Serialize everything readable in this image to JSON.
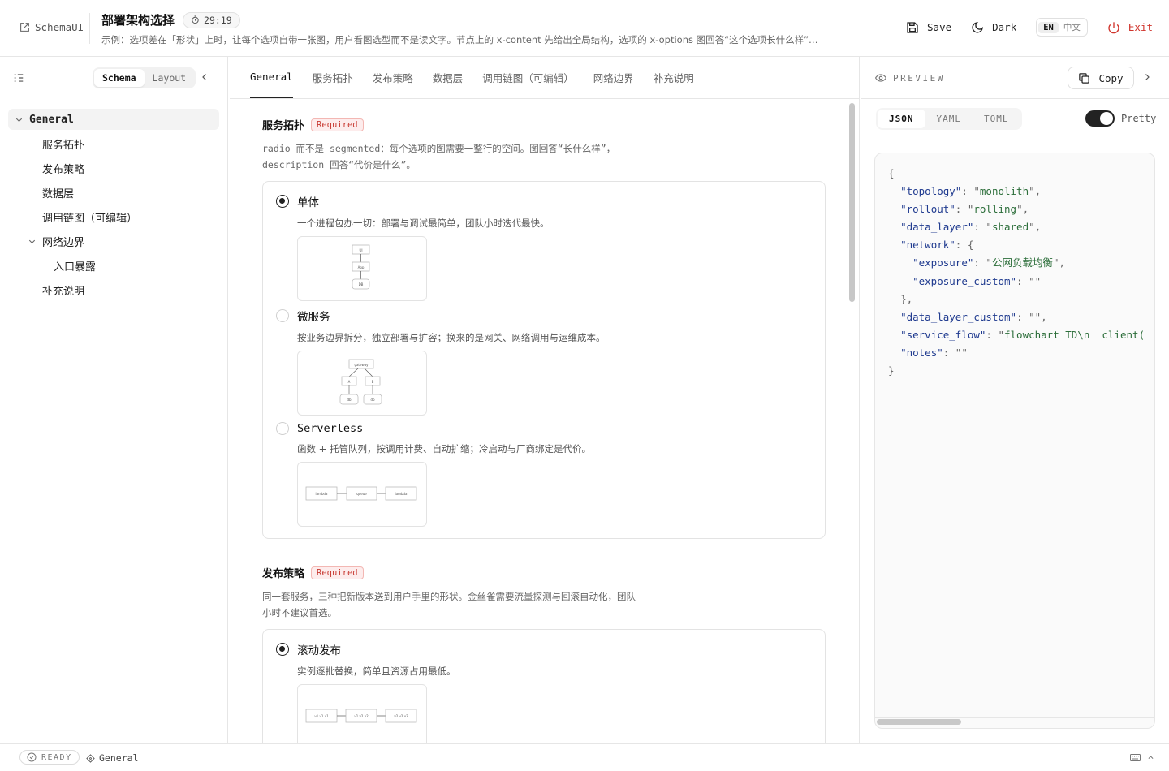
{
  "header": {
    "brand": "SchemaUI",
    "title": "部署架构选择",
    "timer": "29:19",
    "subtitle": "示例：选项差在「形状」上时，让每个选项自带一张图，用户看图选型而不是读文字。节点上的 x-content 先给出全局结构，选项的 x-options 图回答“这个选项长什么样”…",
    "save_label": "Save",
    "theme_label": "Dark",
    "lang_active": "EN",
    "lang_other": "中文",
    "exit_label": "Exit"
  },
  "left_panel": {
    "segments": [
      "Schema",
      "Layout"
    ],
    "active_segment": "Schema",
    "tree": {
      "root": "General",
      "items": [
        "服务拓扑",
        "发布策略",
        "数据层",
        "调用链图（可编辑）"
      ],
      "group": "网络边界",
      "group_children": [
        "入口暴露"
      ],
      "last": "补充说明"
    }
  },
  "tabs": [
    "General",
    "服务拓扑",
    "发布策略",
    "数据层",
    "调用链图（可编辑）",
    "网络边界",
    "补充说明"
  ],
  "active_tab": "General",
  "fields": {
    "topology": {
      "title": "服务拓扑",
      "badge": "Required",
      "desc_line1": "radio 而不是 segmented：每个选项的图需要一整行的空间。图回答“长什么样”，",
      "desc_line2": "description 回答“代价是什么”。",
      "options": [
        {
          "label": "单体",
          "desc": "一个进程包办一切：部署与调试最简单，团队小时迭代最快。",
          "selected": true,
          "diagram_nodes": [
            "UI",
            "App",
            "DB"
          ]
        },
        {
          "label": "微服务",
          "desc": "按业务边界拆分，独立部署与扩容；换来的是网关、网络调用与运维成本。",
          "selected": false,
          "diagram_nodes": [
            "gateway",
            "A",
            "B",
            "db",
            "db"
          ]
        },
        {
          "label": "Serverless",
          "desc": "函数 + 托管队列，按调用计费、自动扩缩；冷启动与厂商绑定是代价。",
          "selected": false,
          "diagram_nodes": [
            "lambda",
            "queue",
            "lambda"
          ]
        }
      ]
    },
    "rollout": {
      "title": "发布策略",
      "badge": "Required",
      "desc_line1": "同一套服务，三种把新版本送到用户手里的形状。金丝雀需要流量探测与回滚自动化，团队",
      "desc_line2": "小时不建议首选。",
      "options": [
        {
          "label": "滚动发布",
          "desc": "实例逐批替换，简单且资源占用最低。",
          "selected": true,
          "diagram_nodes": [
            "v1 v1 v1",
            "v1 v2 v2",
            "v2 v2 v2"
          ]
        }
      ]
    }
  },
  "preview": {
    "label": "PREVIEW",
    "copy_label": "Copy",
    "formats": [
      "JSON",
      "YAML",
      "TOML"
    ],
    "active_format": "JSON",
    "pretty_label": "Pretty",
    "pretty_on": true,
    "json": {
      "topology": "monolith",
      "rollout": "rolling",
      "data_layer": "shared",
      "exposure": "公网负载均衡",
      "exposure_custom": "",
      "data_layer_custom": "",
      "service_flow": "flowchart TD\\n  client(",
      "notes": ""
    }
  },
  "status": {
    "state": "READY",
    "crumb": "General"
  }
}
